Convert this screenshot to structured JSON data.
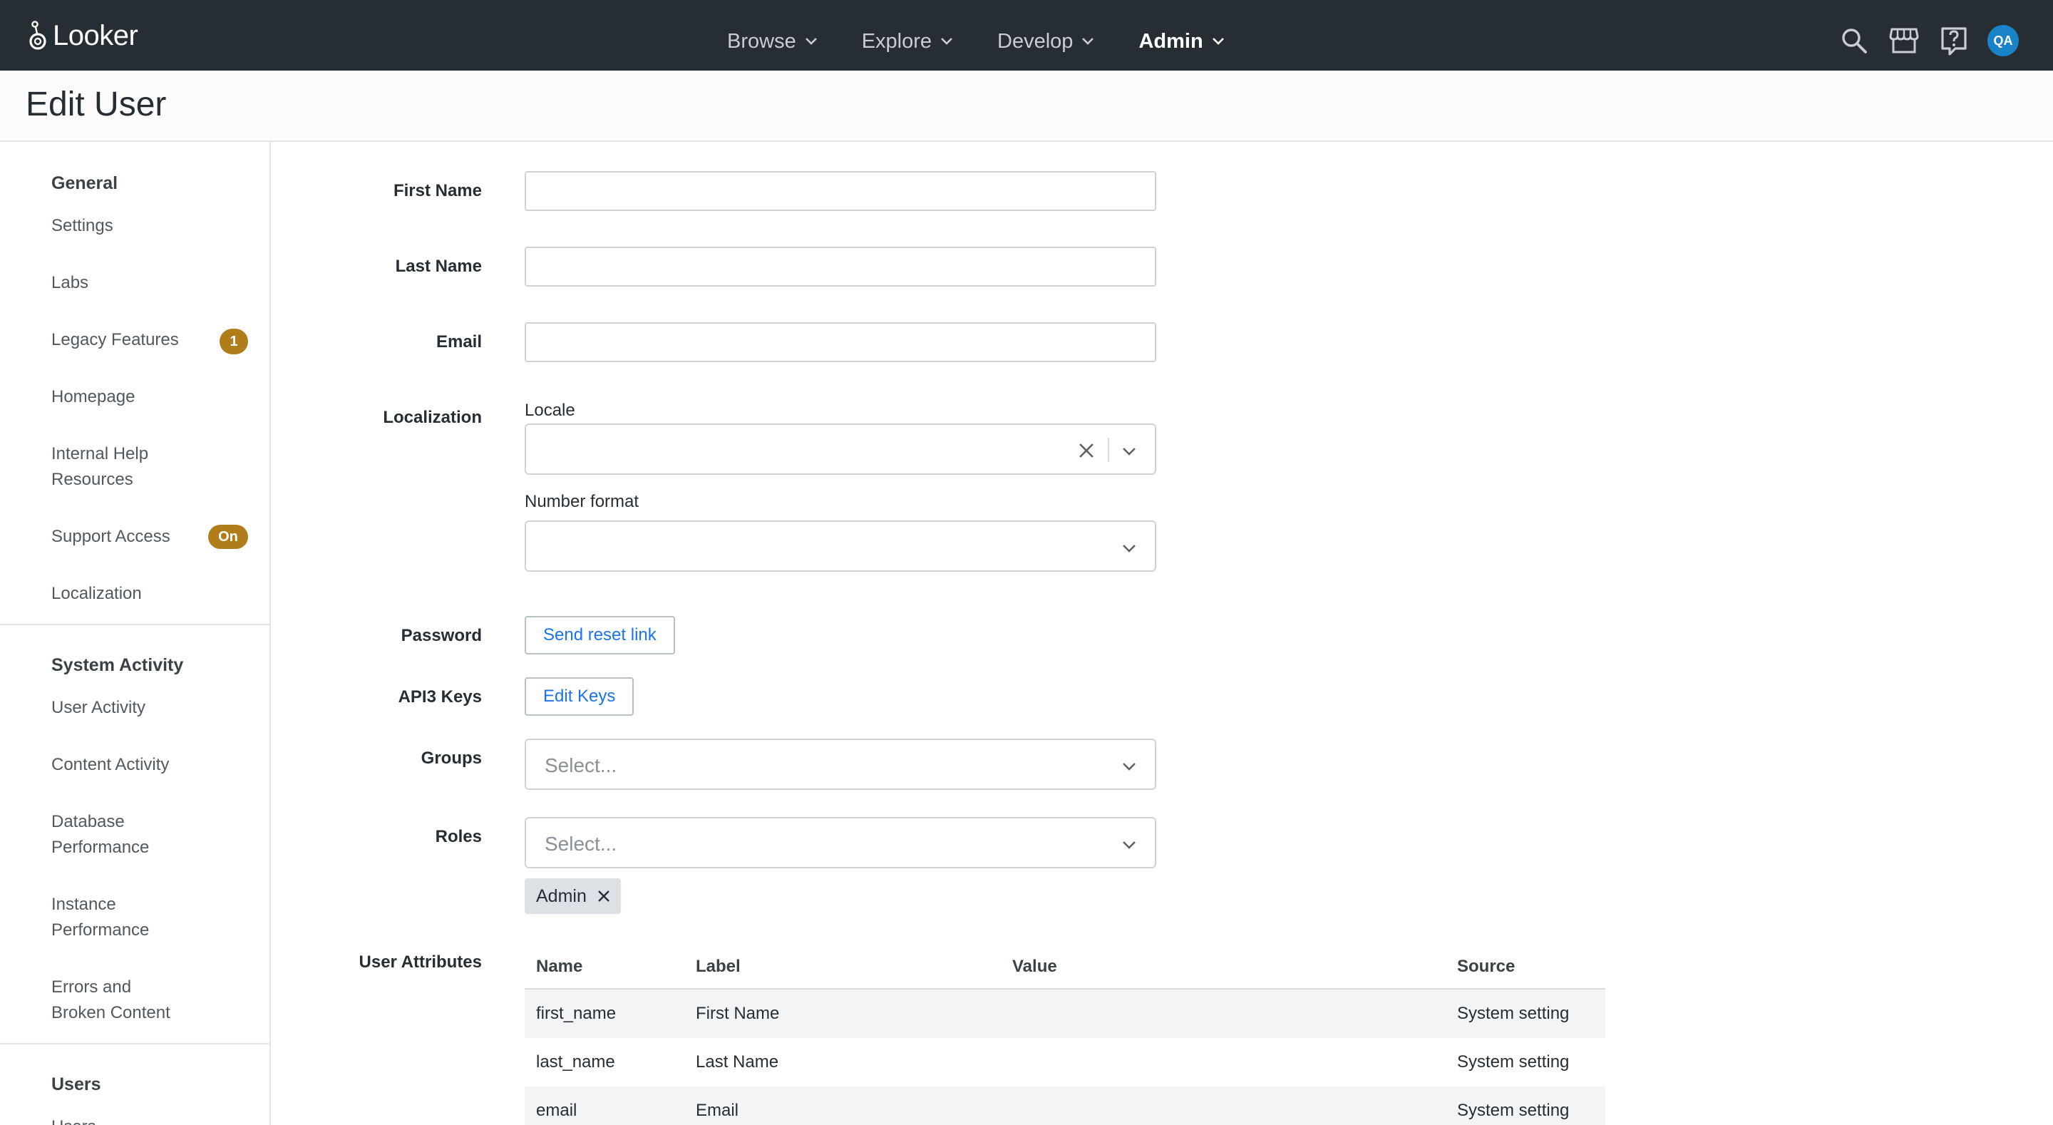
{
  "app": {
    "name": "Looker",
    "nav": [
      {
        "label": "Browse",
        "active": false
      },
      {
        "label": "Explore",
        "active": false
      },
      {
        "label": "Develop",
        "active": false
      },
      {
        "label": "Admin",
        "active": true
      }
    ],
    "icons": [
      "search-icon",
      "marketplace-icon",
      "help-icon"
    ],
    "avatar": "QA",
    "accent": "#1a73e8",
    "badge_color": "#b07d1a"
  },
  "page": {
    "title": "Edit User"
  },
  "sidebar": {
    "sections": [
      {
        "heading": "General",
        "items": [
          {
            "label": "Settings"
          },
          {
            "label": "Labs"
          },
          {
            "label": "Legacy Features",
            "badge": "1"
          },
          {
            "label": "Homepage"
          },
          {
            "label": "Internal Help Resources"
          },
          {
            "label": "Support Access",
            "badge": "On"
          },
          {
            "label": "Localization"
          }
        ]
      },
      {
        "heading": "System Activity",
        "items": [
          {
            "label": "User Activity"
          },
          {
            "label": "Content Activity"
          },
          {
            "label": "Database Performance"
          },
          {
            "label": "Instance Performance"
          },
          {
            "label": "Errors and Broken Content"
          }
        ]
      },
      {
        "heading": "Users",
        "items": [
          {
            "label": "Users"
          }
        ]
      }
    ]
  },
  "form": {
    "first_name": {
      "label": "First Name",
      "value": ""
    },
    "last_name": {
      "label": "Last Name",
      "value": ""
    },
    "email": {
      "label": "Email",
      "value": ""
    },
    "localization": {
      "label": "Localization",
      "locale_label": "Locale",
      "locale_value": "",
      "number_format_label": "Number format",
      "number_format_value": ""
    },
    "password": {
      "label": "Password",
      "button": "Send reset link"
    },
    "api_keys": {
      "label": "API3 Keys",
      "button": "Edit Keys"
    },
    "groups": {
      "label": "Groups",
      "placeholder": "Select..."
    },
    "roles": {
      "label": "Roles",
      "placeholder": "Select...",
      "selected": [
        "Admin"
      ]
    },
    "user_attributes": {
      "label": "User Attributes",
      "columns": [
        "Name",
        "Label",
        "Value",
        "Source"
      ],
      "rows": [
        {
          "name": "first_name",
          "label": "First Name",
          "value": "",
          "source": "System setting"
        },
        {
          "name": "last_name",
          "label": "Last Name",
          "value": "",
          "source": "System setting"
        },
        {
          "name": "email",
          "label": "Email",
          "value": "",
          "source": "System setting"
        }
      ]
    }
  }
}
